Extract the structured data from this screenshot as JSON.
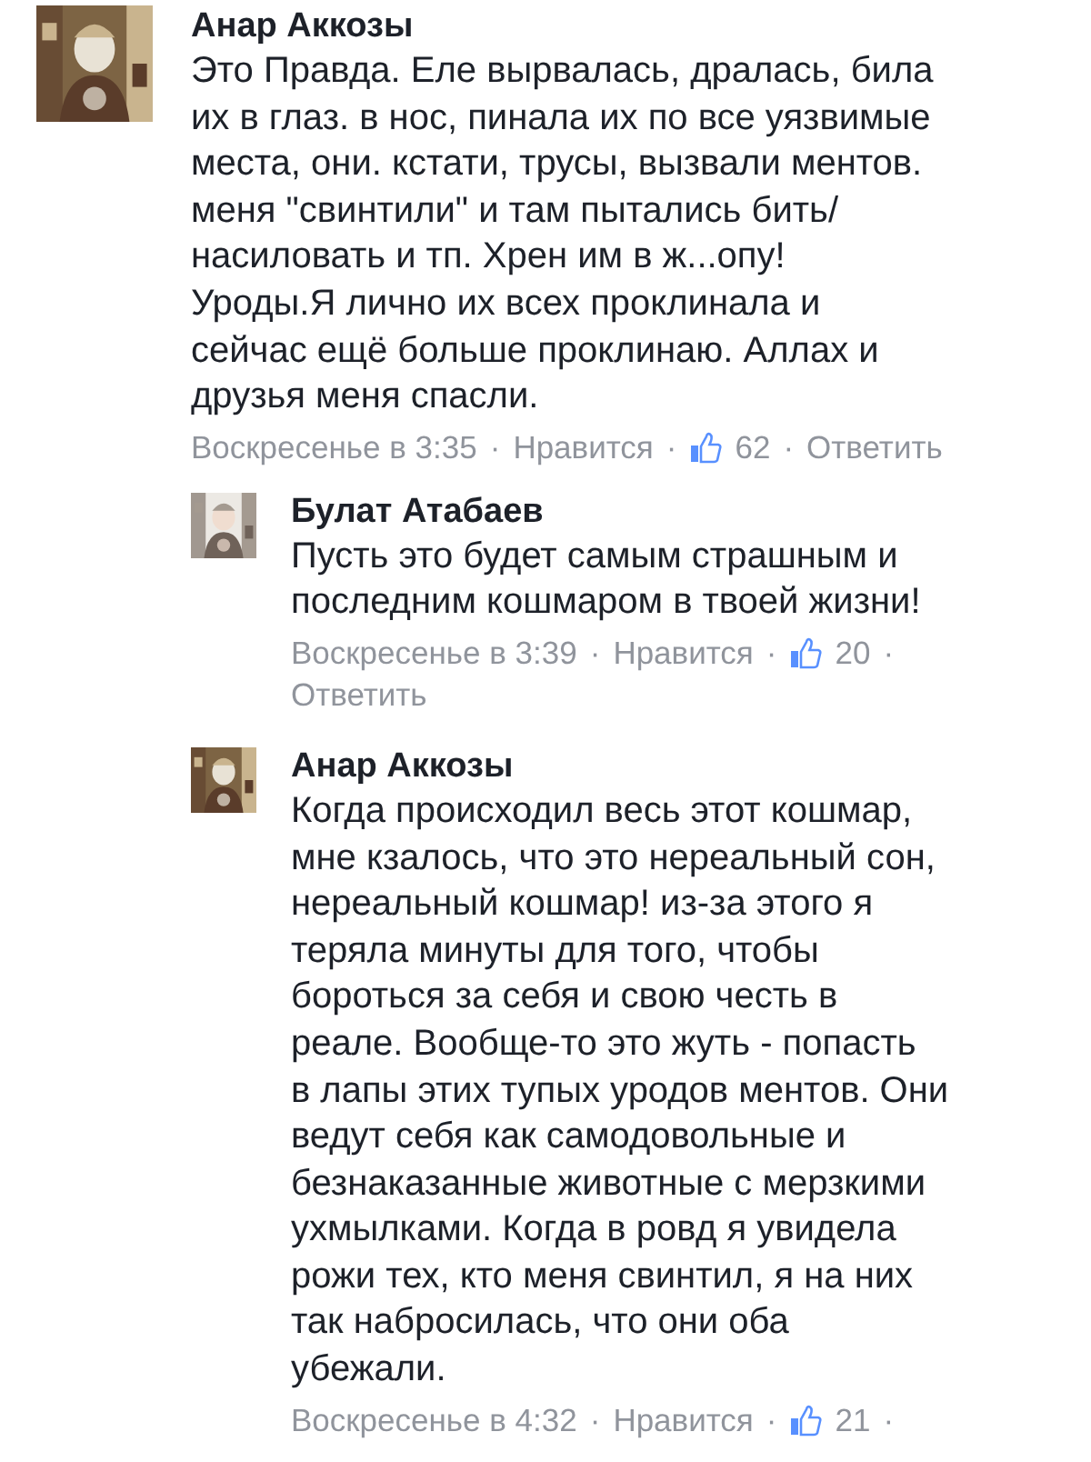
{
  "comments": [
    {
      "author": "Анар Аккозы",
      "text": "Это Правда. Еле вырвалась, дралась, била\nих в глаз. в нос, пинала их по все уязвимые\nместа, они. кстати, трусы, вызвали ментов.\nменя \"свинтили\" и там пытались бить/\nнасиловать и тп. Хрен им в ж...опу!\nУроды.Я лично их всех проклинала и\nсейчас ещё больше проклинаю. Аллах и\nдрузья меня спасли.",
      "time": "Воскресенье в 3:35",
      "separator": "·",
      "like": "Нравится",
      "likes": "62",
      "reply": "Ответить",
      "replies": [
        {
          "author": "Булат Атабаев",
          "text": "Пусть это будет самым страшным  и\nпоследним кошмаром в твоей жизни!",
          "time": "Воскресенье в 3:39",
          "separator": "·",
          "like": "Нравится",
          "likes": "20",
          "reply": "Ответить"
        },
        {
          "author": "Анар Аккозы",
          "text": "Когда происходил весь этот кошмар,\nмне кзалось, что это нереальный сон,\nнереальный кошмар! из-за этого я\nтеряла минуты для того, чтобы\nбороться за себя и свою честь в\nреале. Вообще-то это жуть - попасть\nв лапы этих тупых уродов ментов. Они\nведут себя как самодовольные и\nбезнаказанные животные с мерзкими\nухмылками. Когда в ровд я увидела\nрожи тех, кто меня свинтил, я на них\nтак набросилась, что они оба\nубежали.",
          "time": "Воскресенье в 4:32",
          "separator": "·",
          "like": "Нравится",
          "likes": "21"
        }
      ]
    }
  ]
}
